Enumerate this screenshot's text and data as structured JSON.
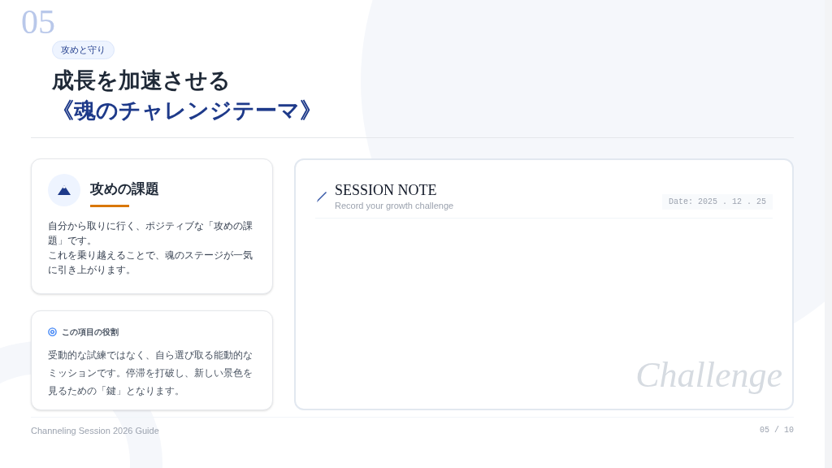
{
  "header": {
    "number": "05",
    "tag": "攻めと守り",
    "title_line1": "成長を加速させる",
    "title_line2": "《魂のチャレンジテーマ》"
  },
  "challenge_card": {
    "title": "攻めの課題",
    "paragraphs": [
      "自分から取りに行く、ポジティブな「攻めの課題」です。",
      "これを乗り越えることで、魂のステージが一気に引き上がります。"
    ]
  },
  "role_card": {
    "heading": "この項目の役割",
    "body": "受動的な試練ではなく、自ら選び取る能動的なミッションです。停滞を打破し、新しい景色を見るための「鍵」となります。"
  },
  "note": {
    "title": "SESSION NOTE",
    "subtitle": "Record your growth challenge",
    "date": "Date: 2025 . 12 . 25",
    "backdrop": "Challenge"
  },
  "footer": {
    "left": "Channeling Session 2026 Guide",
    "right": "05 / 10"
  }
}
